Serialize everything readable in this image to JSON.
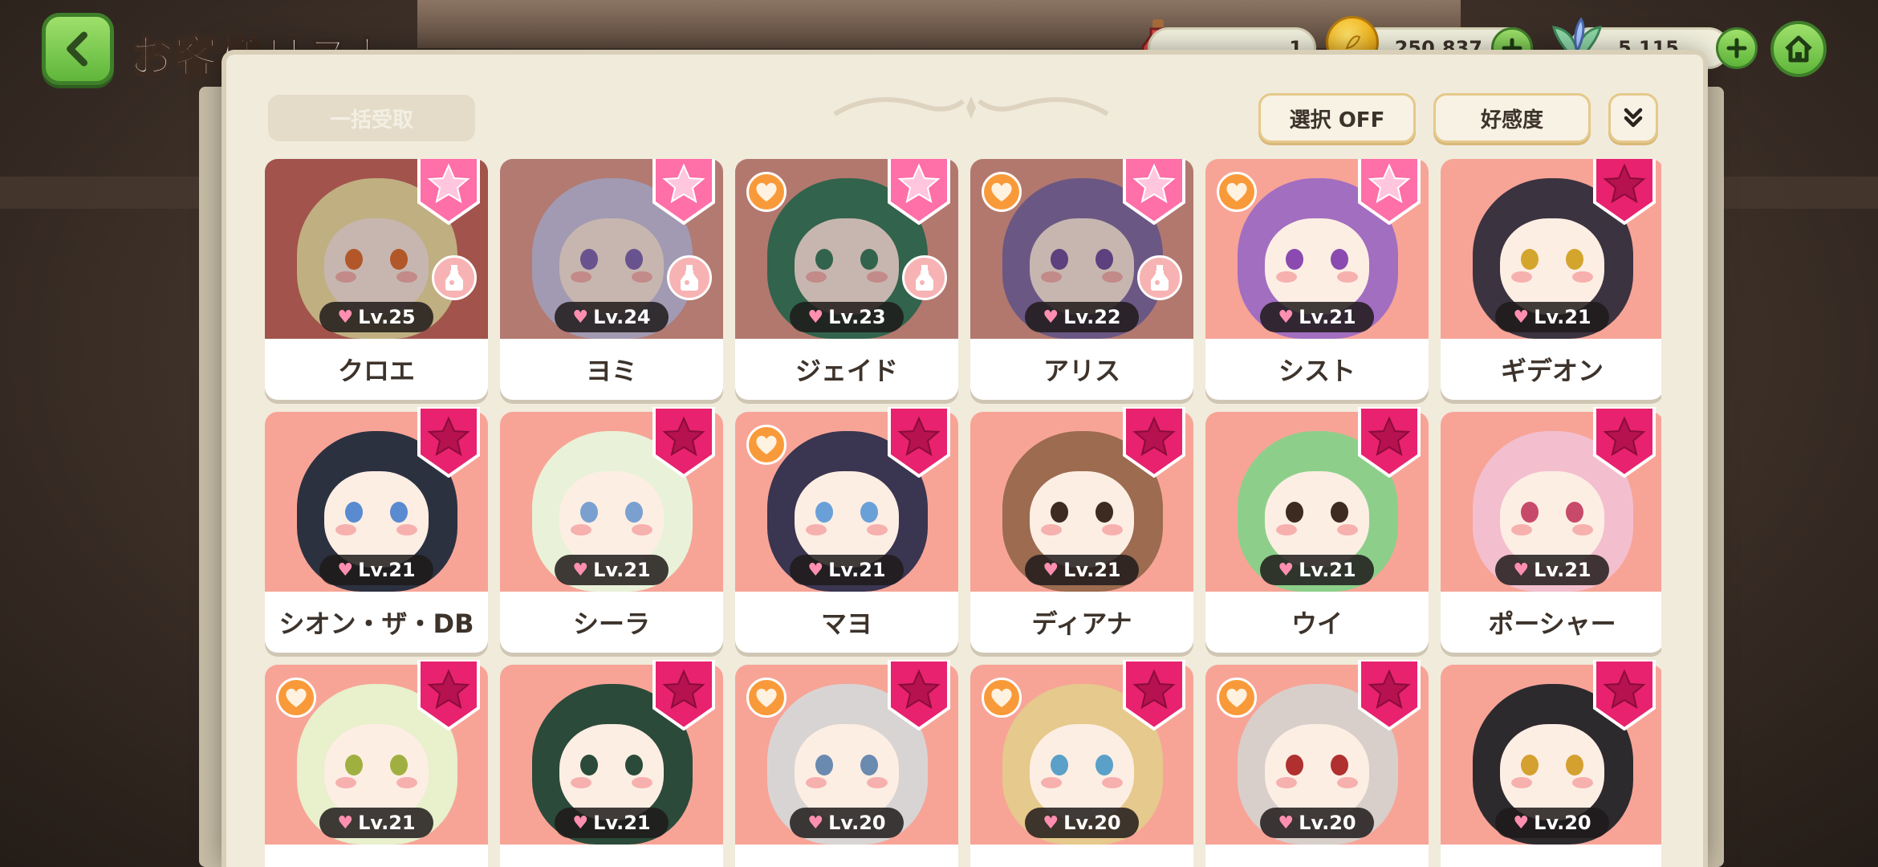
{
  "header": {
    "title": "お客様リスト",
    "potion": "1",
    "gold": "250,837",
    "gem": "5,115"
  },
  "toolbar": {
    "bulk_receive": "一括受取",
    "select": "選択 OFF",
    "sort": "好感度"
  },
  "cards": [
    {
      "name": "クロエ",
      "level": "Lv.25",
      "star": "pink",
      "heart": false,
      "potion": true,
      "hair": "#f3e3a4",
      "bg": "#c8645a",
      "eye": "#e06a2a"
    },
    {
      "name": "ヨミ",
      "level": "Lv.24",
      "star": "pink",
      "heart": false,
      "potion": true,
      "hair": "#c9c6e8",
      "bg": "#e09a8e",
      "eye": "#7a64b8"
    },
    {
      "name": "ジェイド",
      "level": "Lv.23",
      "star": "pink",
      "heart": true,
      "potion": true,
      "hair": "#2f7a5a",
      "bg": "#e0988a",
      "eye": "#2f7a5a"
    },
    {
      "name": "アリス",
      "level": "Lv.22",
      "star": "pink",
      "heart": true,
      "potion": true,
      "hair": "#7d6aa8",
      "bg": "#e0988a",
      "eye": "#6a4aa0"
    },
    {
      "name": "シスト",
      "level": "Lv.21",
      "star": "pink",
      "heart": true,
      "potion": false,
      "hair": "#a26ec0",
      "bg": "#f7a497",
      "eye": "#8a4ab0"
    },
    {
      "name": "ギデオン",
      "level": "Lv.21",
      "star": "dark",
      "heart": false,
      "potion": false,
      "hair": "#3b3340",
      "bg": "#f7a497",
      "eye": "#d4a52c"
    },
    {
      "name": "シオン・ザ・DB",
      "level": "Lv.21",
      "star": "dark",
      "heart": false,
      "potion": false,
      "hair": "#2c3140",
      "bg": "#f7a497",
      "eye": "#5a8ad0"
    },
    {
      "name": "シーラ",
      "level": "Lv.21",
      "star": "dark",
      "heart": false,
      "potion": false,
      "hair": "#e9f2d8",
      "bg": "#f7a497",
      "eye": "#7aa0d0"
    },
    {
      "name": "マヨ",
      "level": "Lv.21",
      "star": "dark",
      "heart": true,
      "potion": false,
      "hair": "#3a3550",
      "bg": "#f7a497",
      "eye": "#6aa0d8"
    },
    {
      "name": "ディアナ",
      "level": "Lv.21",
      "star": "dark",
      "heart": false,
      "potion": false,
      "hair": "#9c6b50",
      "bg": "#f7a497",
      "eye": "#3d2a20"
    },
    {
      "name": "ウイ",
      "level": "Lv.21",
      "star": "dark",
      "heart": false,
      "potion": false,
      "hair": "#8dcf8a",
      "bg": "#f7a497",
      "eye": "#3d2a20"
    },
    {
      "name": "ポーシャー",
      "level": "Lv.21",
      "star": "dark",
      "heart": false,
      "potion": false,
      "hair": "#f3bfcf",
      "bg": "#f7a497",
      "eye": "#c84a6a"
    },
    {
      "name": "",
      "level": "Lv.21",
      "star": "dark",
      "heart": true,
      "potion": false,
      "hair": "#e8f0cc",
      "bg": "#f7a497",
      "eye": "#a0b040"
    },
    {
      "name": "",
      "level": "Lv.21",
      "star": "dark",
      "heart": false,
      "potion": false,
      "hair": "#2b4a3a",
      "bg": "#f7a497",
      "eye": "#2b4a3a"
    },
    {
      "name": "",
      "level": "Lv.20",
      "star": "dark",
      "heart": true,
      "potion": false,
      "hair": "#d9d4d4",
      "bg": "#f7a497",
      "eye": "#6a8ab0"
    },
    {
      "name": "",
      "level": "Lv.20",
      "star": "dark",
      "heart": true,
      "potion": false,
      "hair": "#e6c98c",
      "bg": "#f7a497",
      "eye": "#5aa0c8"
    },
    {
      "name": "",
      "level": "Lv.20",
      "star": "dark",
      "heart": true,
      "potion": false,
      "hair": "#d8cfcb",
      "bg": "#f7a497",
      "eye": "#b03030"
    },
    {
      "name": "",
      "level": "Lv.20",
      "star": "dark",
      "heart": false,
      "potion": false,
      "hair": "#2d2a2e",
      "bg": "#f7a497",
      "eye": "#d4a030"
    }
  ]
}
